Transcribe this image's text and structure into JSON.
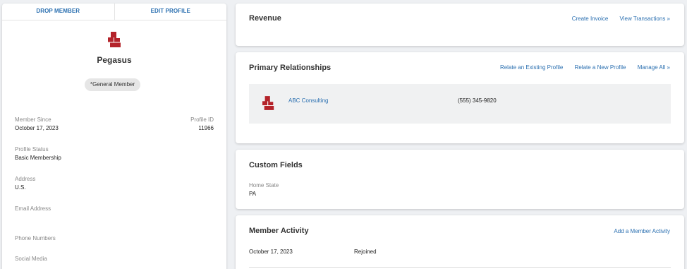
{
  "profile": {
    "actions": [
      "DROP MEMBER",
      "EDIT PROFILE"
    ],
    "logo_icon": "building-icon",
    "name": "Pegasus",
    "badge": "*General Member",
    "member_since": {
      "label": "Member Since",
      "value": "October 17, 2023"
    },
    "profile_id": {
      "label": "Profile ID",
      "value": "11966"
    },
    "profile_status": {
      "label": "Profile Status",
      "value": "Basic Membership"
    },
    "address": {
      "label": "Address",
      "value": "U.S."
    },
    "email": {
      "label": "Email Address"
    },
    "phone": {
      "label": "Phone Numbers"
    },
    "social": {
      "label": "Social Media"
    }
  },
  "revenue": {
    "title": "Revenue",
    "links": [
      "Create Invoice",
      "View Transactions »"
    ]
  },
  "primary_relationships": {
    "title": "Primary Relationships",
    "links": [
      "Relate an Existing Profile",
      "Relate a New Profile",
      "Manage All »"
    ],
    "items": [
      {
        "name": "ABC Consulting",
        "phone": "(555) 345-9820"
      }
    ]
  },
  "custom_fields": {
    "title": "Custom Fields",
    "fields": [
      {
        "label": "Home State",
        "value": "PA"
      }
    ]
  },
  "member_activity": {
    "title": "Member Activity",
    "links": [
      "Add a Member Activity"
    ],
    "items": [
      {
        "date": "October 17, 2023",
        "description": "Rejoined"
      }
    ]
  },
  "colors": {
    "accent": "#2a6fb0",
    "logo": "#b4232a"
  }
}
